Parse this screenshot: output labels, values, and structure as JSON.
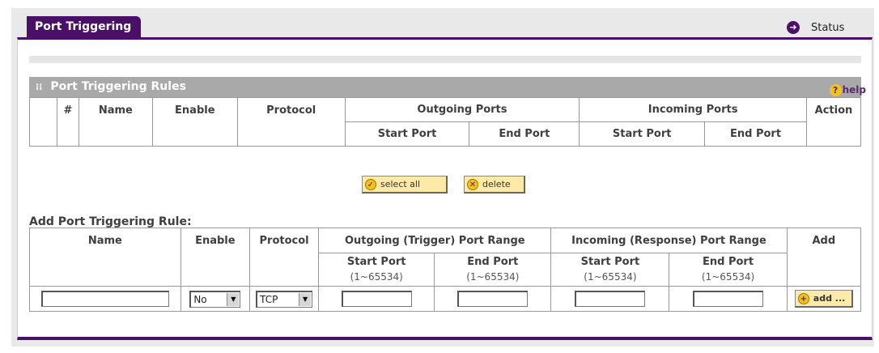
{
  "tab": {
    "label": "Port Triggering"
  },
  "status_link": {
    "label": "Status"
  },
  "section": {
    "title": "Port Triggering Rules",
    "help_label": "help"
  },
  "rules_table": {
    "headers": {
      "num": "#",
      "name": "Name",
      "enable": "Enable",
      "protocol": "Protocol",
      "outgoing": "Outgoing Ports",
      "incoming": "Incoming Ports",
      "action": "Action",
      "start_port": "Start Port",
      "end_port": "End Port"
    }
  },
  "buttons": {
    "select_all": "select all",
    "delete": "delete",
    "add": "add ..."
  },
  "add_rule": {
    "title": "Add Port Triggering Rule:",
    "headers": {
      "name": "Name",
      "enable": "Enable",
      "protocol": "Protocol",
      "outgoing": "Outgoing (Trigger) Port Range",
      "incoming": "Incoming (Response) Port Range",
      "add": "Add",
      "start_port": "Start Port",
      "end_port": "End Port",
      "range": "(1~65534)"
    },
    "enable_value": "No",
    "protocol_value": "TCP"
  }
}
